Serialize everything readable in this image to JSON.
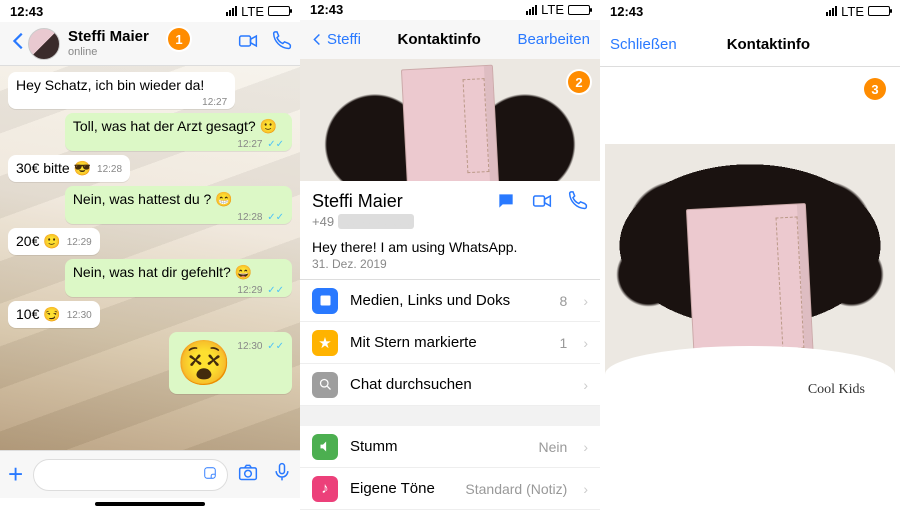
{
  "status_bar": {
    "time": "12:43",
    "network": "LTE"
  },
  "screen1": {
    "badge": "1",
    "contact_name": "Steffi  Maier",
    "presence": "online",
    "messages": [
      {
        "dir": "in",
        "text": "Hey Schatz, ich bin wieder da!",
        "time": "12:27"
      },
      {
        "dir": "out",
        "text": "Toll, was hat der Arzt gesagt? 🙂",
        "time": "12:27",
        "read": true
      },
      {
        "dir": "in",
        "text": "30€ bitte 😎",
        "time": "12:28"
      },
      {
        "dir": "out",
        "text": "Nein, was hattest du ? 😁",
        "time": "12:28",
        "read": true
      },
      {
        "dir": "in",
        "text": "20€ 🙂",
        "time": "12:29"
      },
      {
        "dir": "out",
        "text": "Nein, was hat dir gefehlt? 😄",
        "time": "12:29",
        "read": true
      },
      {
        "dir": "in",
        "text": "10€ 😏",
        "time": "12:30"
      },
      {
        "dir": "out",
        "text": "😵",
        "time": "12:30",
        "read": true,
        "big": true
      }
    ]
  },
  "screen2": {
    "badge": "2",
    "back": "Steffi",
    "title": "Kontaktinfo",
    "edit": "Bearbeiten",
    "contact_name": "Steffi  Maier",
    "phone_prefix": "+49",
    "status": "Hey there! I am using WhatsApp.",
    "status_date": "31. Dez. 2019",
    "rows": {
      "media": {
        "label": "Medien, Links und Doks",
        "value": "8"
      },
      "starred": {
        "label": "Mit Stern markierte",
        "value": "1"
      },
      "search": {
        "label": "Chat durchsuchen",
        "value": ""
      },
      "mute": {
        "label": "Stumm",
        "value": "Nein"
      },
      "tones": {
        "label": "Eigene Töne",
        "value": "Standard (Notiz)"
      }
    }
  },
  "screen3": {
    "badge": "3",
    "close": "Schließen",
    "title": "Kontaktinfo",
    "shirt_text": "Cool Kids"
  }
}
